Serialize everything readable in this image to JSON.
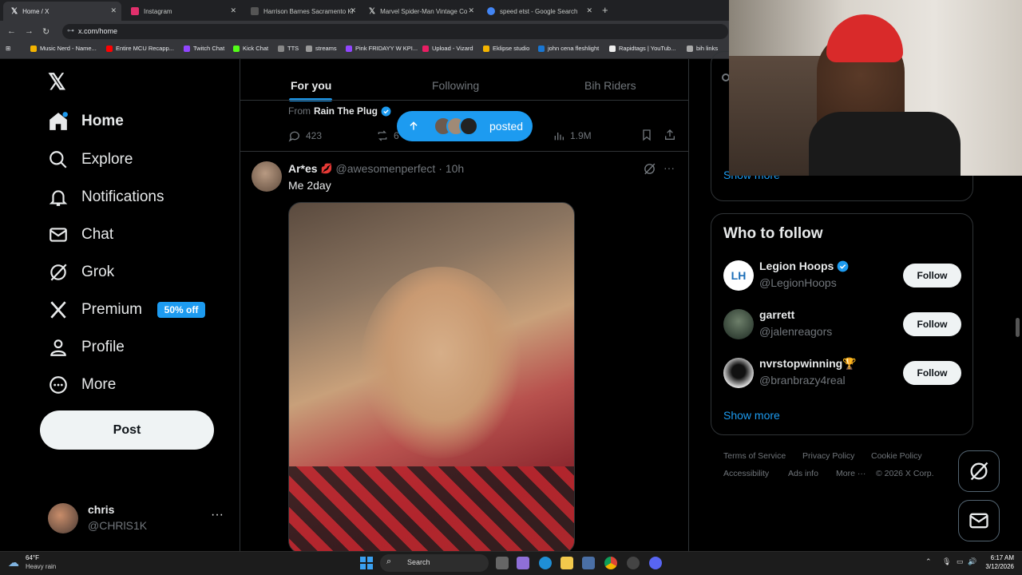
{
  "browser": {
    "tabs": [
      {
        "label": "Home / X",
        "active": true,
        "color": "#ffffff"
      },
      {
        "label": "Instagram",
        "color": "#e1306c"
      },
      {
        "label": "Harrison Barnes Sacramento Ki",
        "color": "#444444"
      },
      {
        "label": "Marvel Spider-Man Vintage Co",
        "color": "#444444"
      },
      {
        "label": "speed etst - Google Search",
        "color": "#4285f4"
      }
    ],
    "url": "x.com/home",
    "bookmarks": [
      "Music Nerd - Name...",
      "Entire MCU Recapp...",
      "Twitch Chat",
      "Kick Chat",
      "TTS",
      "streams",
      "Pink FRIDAYY W KPI...",
      "Upload - Vizard",
      "Eklipse studio",
      "john cena fleshlight",
      "Rapidtags | YouTub...",
      "bih links"
    ]
  },
  "sidebar": {
    "items": [
      {
        "label": "Home",
        "icon": "home-icon"
      },
      {
        "label": "Explore",
        "icon": "search-icon"
      },
      {
        "label": "Notifications",
        "icon": "bell-icon"
      },
      {
        "label": "Chat",
        "icon": "mail-icon"
      },
      {
        "label": "Grok",
        "icon": "grok-icon"
      },
      {
        "label": "Premium",
        "icon": "x-logo-icon"
      },
      {
        "label": "Profile",
        "icon": "person-icon"
      },
      {
        "label": "More",
        "icon": "more-circle-icon"
      }
    ],
    "premium_badge": "50% off",
    "post_label": "Post",
    "account": {
      "name": "chris",
      "handle": "@CHRlS1K"
    }
  },
  "feed": {
    "tabs": [
      "For you",
      "Following",
      "Bih Riders"
    ],
    "prev_post": {
      "from_prefix": "From",
      "from_name": "Rain The Plug",
      "replies": "423",
      "reposts": "6",
      "views": "1.9M"
    },
    "posted_pill": "posted",
    "post": {
      "name": "Ar*es",
      "handle": "@awesomenperfect",
      "time": "· 10h",
      "text": "Me 2day"
    }
  },
  "right": {
    "show_more_top": "Show more",
    "who_to_follow_title": "Who to follow",
    "suggestions": [
      {
        "name": "Legion Hoops",
        "handle": "@LegionHoops",
        "verified": true,
        "button": "Follow"
      },
      {
        "name": "garrett",
        "handle": "@jalenreagors",
        "verified": false,
        "button": "Follow"
      },
      {
        "name": "nvrstopwinning🏆",
        "handle": "@branbrazy4real",
        "verified": false,
        "button": "Follow"
      }
    ],
    "show_more_bottom": "Show more",
    "footer": [
      "Terms of Service",
      "Privacy Policy",
      "Cookie Policy",
      "Accessibility",
      "Ads info",
      "More ···",
      "© 2026 X Corp."
    ]
  },
  "taskbar": {
    "weather_temp": "64°F",
    "weather_desc": "Heavy rain",
    "search": "Search",
    "time": "6:17 AM",
    "date": "3/12/2026"
  },
  "colors": {
    "accent": "#1d9bf0",
    "border": "#2f3336",
    "muted": "#71767b"
  }
}
